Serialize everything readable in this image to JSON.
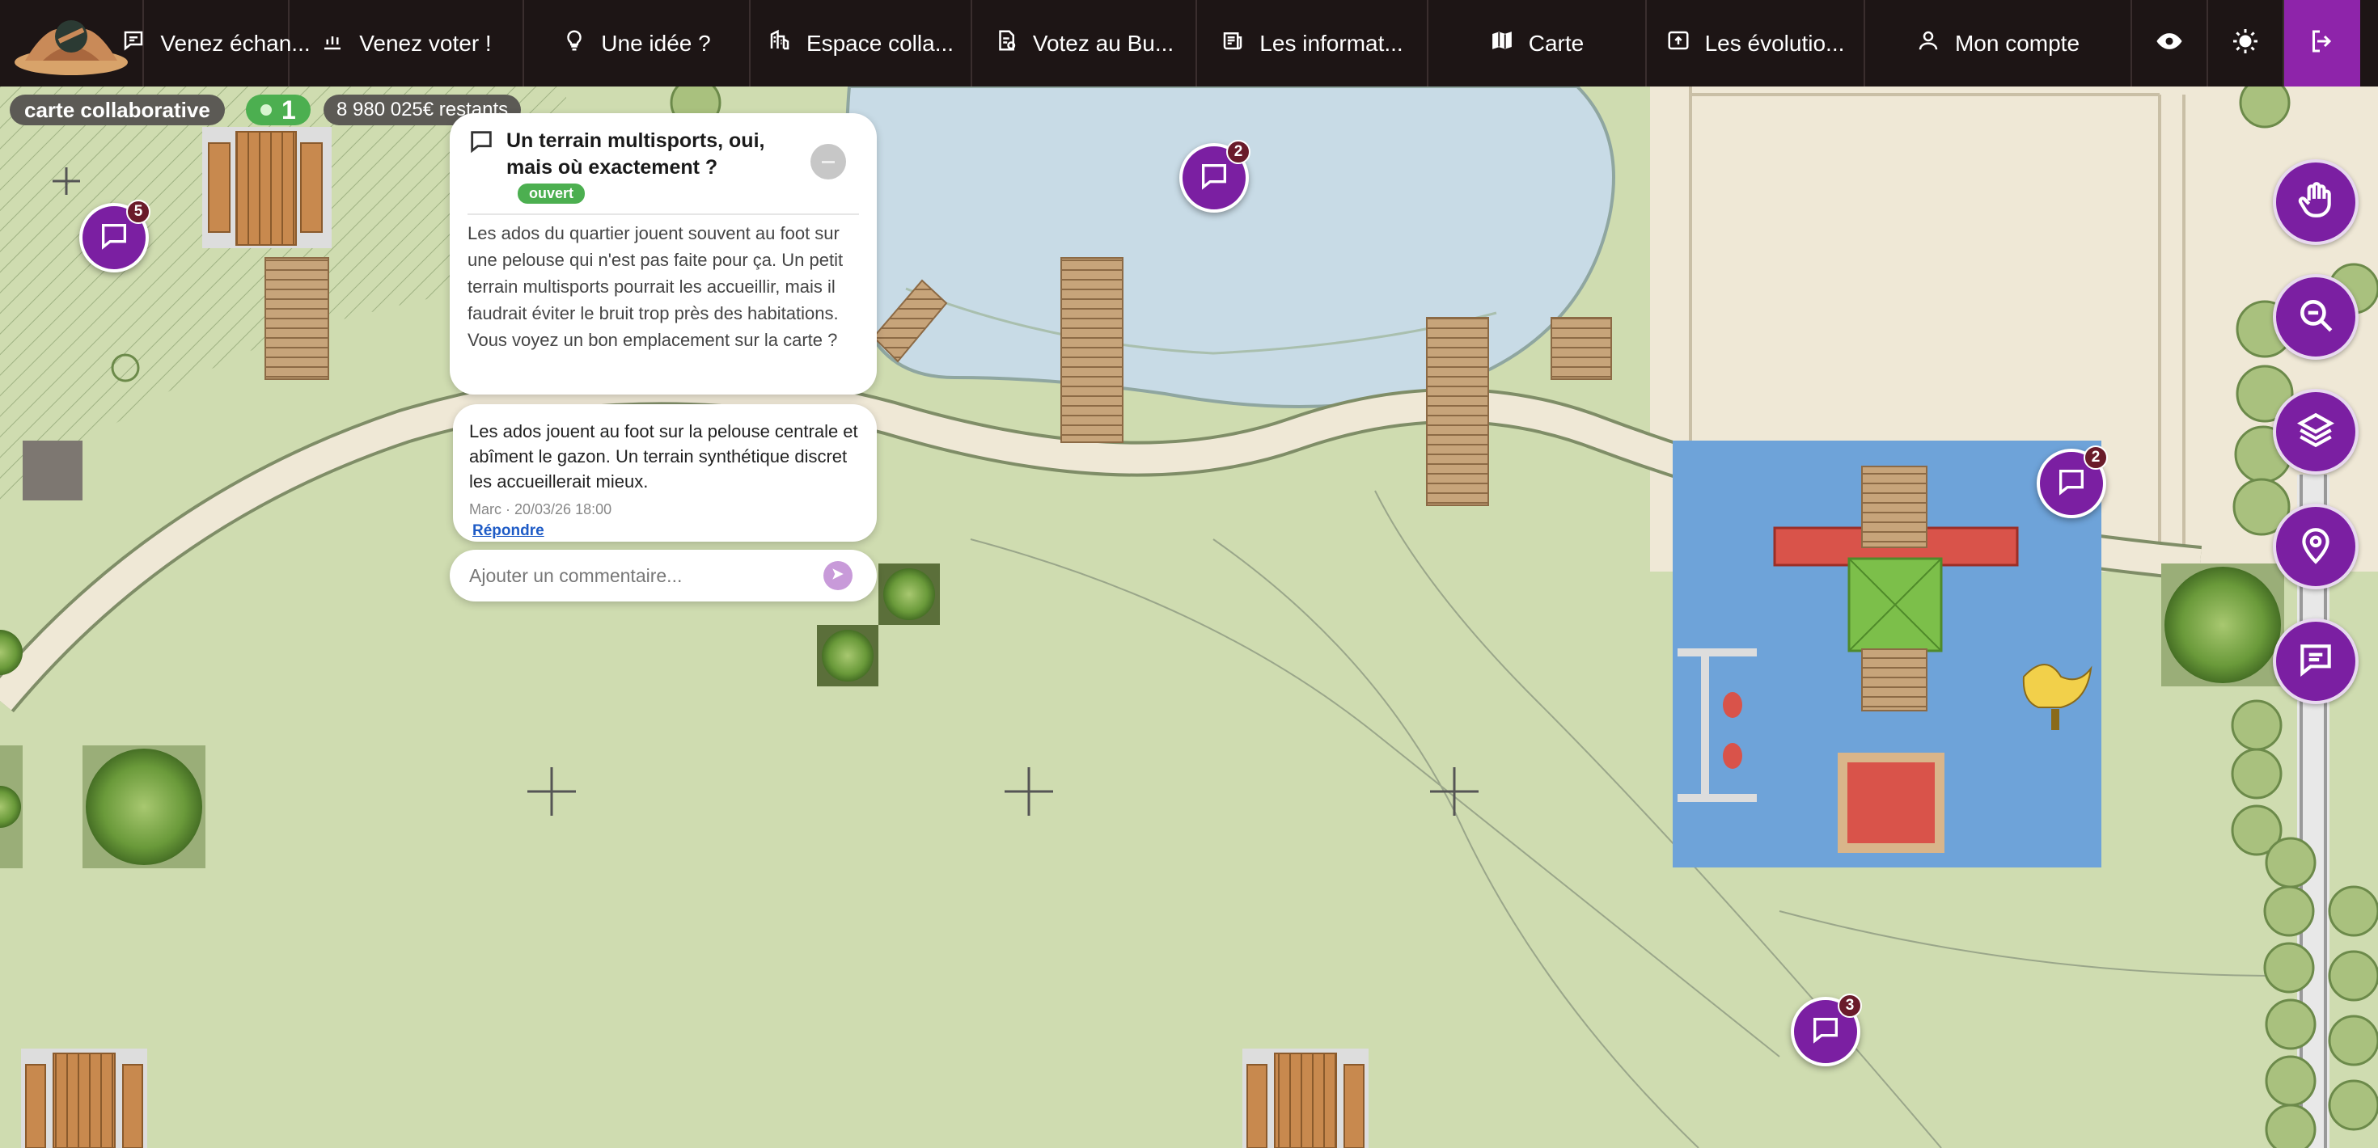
{
  "nav": {
    "items": [
      {
        "label": "Venez échan...",
        "icon": "chat-icon"
      },
      {
        "label": "Venez voter !",
        "icon": "chart-icon"
      },
      {
        "label": "Une idée ?",
        "icon": "lightbulb-icon"
      },
      {
        "label": "Espace colla...",
        "icon": "collab-icon"
      },
      {
        "label": "Votez au Bu...",
        "icon": "budget-icon"
      },
      {
        "label": "Les informat...",
        "icon": "news-icon"
      },
      {
        "label": "Carte",
        "icon": "map-icon"
      },
      {
        "label": "Les évolutio...",
        "icon": "evolution-icon"
      },
      {
        "label": "Mon compte",
        "icon": "user-icon"
      }
    ],
    "eye_icon": "eye-icon",
    "theme_icon": "sun-icon",
    "logout_icon": "logout-icon"
  },
  "map": {
    "title": "carte collaborative",
    "online_count": "1",
    "budget_remaining": "8 980 025€ restants",
    "markers": [
      {
        "count": "5"
      },
      {
        "count": "2"
      },
      {
        "count": "2"
      },
      {
        "count": "3"
      }
    ]
  },
  "topic": {
    "title": "Un terrain multisports, oui, mais où exactement ?",
    "status": "ouvert",
    "body": "Les ados du quartier jouent souvent au foot sur une pelouse qui n'est pas faite pour ça. Un petit terrain multisports pourrait les accueillir, mais il faudrait éviter le bruit trop près des habitations. Vous voyez un bon emplacement sur la carte ?"
  },
  "comment": {
    "text": "Les ados jouent au foot sur la pelouse centrale et abîment le gazon. Un terrain synthétique discret les accueillerait mieux.",
    "meta": "Marc · 20/03/26 18:00",
    "reply_label": "Répondre"
  },
  "add_comment": {
    "placeholder": "Ajouter un commentaire..."
  },
  "colors": {
    "topbar": "#1d1515",
    "accent": "#7b1fa2",
    "logout": "#8e24aa",
    "status_green": "#4caf50",
    "grass": "#cfdcb0",
    "water": "#c8dbe6",
    "playground": "#6ea3d9"
  }
}
